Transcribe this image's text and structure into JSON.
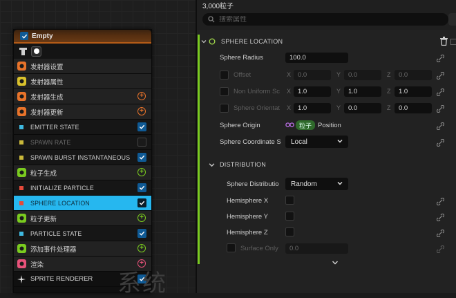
{
  "node": {
    "title": "Empty",
    "rows": [
      {
        "label": "发射器设置",
        "kind": "group",
        "icon": "emitter-settings-icon",
        "color": "#e8732a",
        "right": "none"
      },
      {
        "label": "发射器属性",
        "kind": "group",
        "icon": "emitter-properties-icon",
        "color": "#d9c12c",
        "right": "none"
      },
      {
        "label": "发射器生成",
        "kind": "group",
        "icon": "emitter-spawn-icon",
        "color": "#e8732a",
        "right": "plus"
      },
      {
        "label": "发射器更新",
        "kind": "group",
        "icon": "emitter-update-icon",
        "color": "#e8732a",
        "right": "plus"
      },
      {
        "label": "EMITTER STATE",
        "kind": "mod",
        "icon": "module-icon",
        "color": "#3fb9e0",
        "right": "check"
      },
      {
        "label": "SPAWN RATE",
        "kind": "mod disabled",
        "icon": "module-icon",
        "color": "#c9b83a",
        "right": "check-off"
      },
      {
        "label": "SPAWN BURST INSTANTANEOUS",
        "kind": "mod",
        "icon": "module-icon",
        "color": "#c9b83a",
        "right": "check"
      },
      {
        "label": "粒子生成",
        "kind": "group",
        "icon": "particle-spawn-icon",
        "color": "#7acb1f",
        "right": "plus"
      },
      {
        "label": "INITIALIZE PARTICLE",
        "kind": "mod",
        "icon": "module-icon",
        "color": "#e64a3a",
        "right": "check"
      },
      {
        "label": "SPHERE LOCATION",
        "kind": "mod selected",
        "icon": "module-icon",
        "color": "#e64a3a",
        "right": "check"
      },
      {
        "label": "粒子更新",
        "kind": "group",
        "icon": "particle-update-icon",
        "color": "#7acb1f",
        "right": "plus"
      },
      {
        "label": "PARTICLE STATE",
        "kind": "mod",
        "icon": "module-icon",
        "color": "#3fb9e0",
        "right": "check"
      },
      {
        "label": "添加事件处理器",
        "kind": "group",
        "icon": "event-handler-icon",
        "color": "#7acb1f",
        "right": "plus"
      },
      {
        "label": "渲染",
        "kind": "group",
        "icon": "render-icon",
        "color": "#e8527a",
        "right": "plus-pink"
      },
      {
        "label": "SPRITE RENDERER",
        "kind": "dark",
        "icon": "sprite-renderer-icon",
        "color": "#e0e0e0",
        "right": "check"
      }
    ]
  },
  "watermark": "系统",
  "panel": {
    "count": "3,000粒子",
    "search_placeholder": "搜索属性",
    "sphere_section": "SPHERE LOCATION",
    "sphere_radius_label": "Sphere Radius",
    "sphere_radius_value": "100.0",
    "offset_label": "Offset",
    "offset_values": [
      "0.0",
      "0.0",
      "0.0"
    ],
    "nonuniform_label": "Non Uniform Sc",
    "nonuniform_values": [
      "1.0",
      "1.0",
      "1.0"
    ],
    "orientation_label": "Sphere Orientat",
    "orientation_values": [
      "1.0",
      "0.0",
      "0.0"
    ],
    "axis_x": "X",
    "axis_y": "Y",
    "axis_z": "Z",
    "origin_label": "Sphere Origin",
    "origin_pill": "粒子",
    "origin_value": "Position",
    "coord_label": "Sphere Coordinate S",
    "coord_value": "Local",
    "distribution_section": "DISTRIBUTION",
    "distribution_label": "Sphere Distributio",
    "distribution_value": "Random",
    "hemi_x": "Hemisphere X",
    "hemi_y": "Hemisphere Y",
    "hemi_z": "Hemisphere Z",
    "surface_label": "Surface Only",
    "surface_value": "0.0"
  },
  "colors": {
    "accent_green": "#7acb1f",
    "selection_blue": "#26b7ef",
    "header_orange": "#b55c17",
    "checkbox_blue": "#0f5a95"
  }
}
